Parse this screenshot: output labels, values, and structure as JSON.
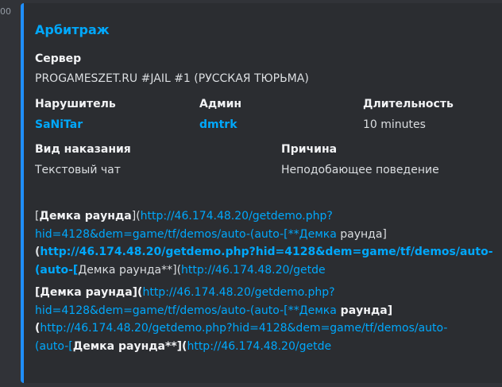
{
  "timestamp": "00",
  "embed": {
    "accent_color": "#1f8fff",
    "title": "Арбитраж",
    "server_label": "Сервер",
    "server_value": "PROGAMESZET.RU #JAIL #1 (РУССКАЯ ТЮРЬМА)",
    "violator_label": "Нарушитель",
    "violator_value": "SaNiTar",
    "admin_label": "Админ",
    "admin_value": "dmtrk",
    "duration_label": "Длительность",
    "duration_value": "10 minutes",
    "punishment_label": "Вид наказания",
    "punishment_value": "Текстовый чат",
    "reason_label": "Причина",
    "reason_value": "Неподобающее поведение"
  },
  "description": {
    "block1": {
      "l1_a": "[",
      "l1_b": "Демка раунда",
      "l1_c": "](",
      "l1_d": "http://46.174.48.20/getdemo.php?",
      "l2_a": "hid=4128&dem=game/tf/demos/auto-(auto-[**",
      "l2_b": "Демка",
      "l2_c": " раунда",
      "l2_d": "]",
      "l3_a": "(",
      "l3_b": "http://46.174.48.20/getdemo.php?hid=4128&dem=game/tf/demos/auto-",
      "l4_a": "(auto-[",
      "l4_b": "Демка раунда**](",
      "l4_c": "http://46.174.48.20/getde"
    },
    "block2": {
      "l1_a": "[Демка раунда](",
      "l1_b": "http://46.174.48.20/getdemo.php?",
      "l2_a": "hid=4128&dem=game/tf/demos/auto-(auto-[**Демка",
      "l2_b": " раунда]",
      "l3_a": "(",
      "l3_b": "http://46.174.48.20/getdemo.php?hid=4128&dem=game/tf/demos/auto-",
      "l4_a": "(auto-[",
      "l4_b": "Демка раунда**](",
      "l4_c": "http://46.174.48.20/getde"
    }
  }
}
